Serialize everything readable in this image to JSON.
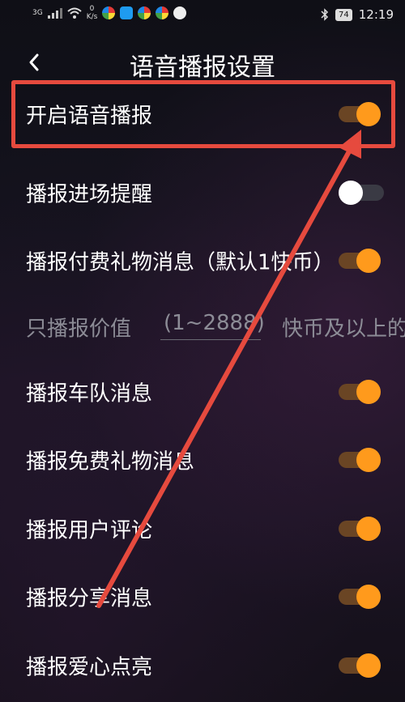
{
  "status_bar": {
    "signal": "3G",
    "net_speed_value": "0",
    "net_speed_unit": "K/s",
    "battery": "74",
    "time": "12:19"
  },
  "header": {
    "title": "语音播报设置"
  },
  "settings": [
    {
      "label": "开启语音播报",
      "enabled": true
    },
    {
      "label": "播报进场提醒",
      "enabled": false
    },
    {
      "label": "播报付费礼物消息（默认1快币）",
      "enabled": true
    }
  ],
  "value_row": {
    "label": "只播报价值",
    "placeholder": "(1~2888)",
    "suffix": "快币及以上的"
  },
  "settings_more": [
    {
      "label": "播报车队消息",
      "enabled": true
    },
    {
      "label": "播报免费礼物消息",
      "enabled": true
    },
    {
      "label": "播报用户评论",
      "enabled": true
    },
    {
      "label": "播报分享消息",
      "enabled": true
    },
    {
      "label": "播报爱心点亮",
      "enabled": true
    }
  ],
  "colors": {
    "accent": "#ff9a1c",
    "highlight": "#e64a3e"
  }
}
